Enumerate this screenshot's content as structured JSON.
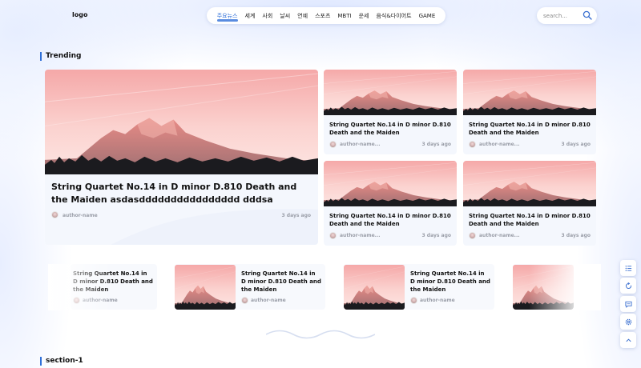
{
  "header": {
    "logo": "logo",
    "nav": [
      "주요뉴스",
      "세계",
      "사회",
      "날씨",
      "연예",
      "스포츠",
      "MBTI",
      "운세",
      "음식&다이어트",
      "GAME"
    ],
    "active_index": 0,
    "search_placeholder": "search..."
  },
  "trending": {
    "heading": "Trending",
    "featured": {
      "title": "String Quartet No.14 in D minor D.810 Death and the Maiden asdasdddddddddddddddd dddsa",
      "author": "author-name",
      "date": "3 days ago"
    },
    "grid": [
      {
        "title": "String Quartet No.14 in D minor D.810 Death and the Maiden asdasdddddddddddddddd...",
        "author": "author-name...",
        "date": "3 days ago"
      },
      {
        "title": "String Quartet No.14 in D minor D.810 Death and the Maiden asdasdddddddddddddddd...",
        "author": "author-name...",
        "date": "3 days ago"
      },
      {
        "title": "String Quartet No.14 in D minor D.810 Death and the Maiden asdasdddddddddddddddd...",
        "author": "author-name...",
        "date": "3 days ago"
      },
      {
        "title": "String Quartet No.14 in D minor D.810 Death and the Maiden asdasdddddddddddddddd...",
        "author": "author-name...",
        "date": "3 days ago"
      }
    ]
  },
  "carousel": [
    {
      "title": "String Quartet No.14 in D minor D.810 Death and the Maiden",
      "author": "author-name"
    },
    {
      "title": "String Quartet No.14 in D minor D.810 Death and the Maiden",
      "author": "author-name"
    },
    {
      "title": "String Quartet No.14 in D minor D.810 Death and the Maiden",
      "author": "author-name"
    }
  ],
  "section1": {
    "heading": "section-1"
  },
  "side_buttons": [
    "list-icon",
    "refresh-icon",
    "chat-icon",
    "settings-icon",
    "chevron-up-icon"
  ],
  "colors": {
    "accent": "#2f6fd8",
    "card_bg": "#f4f7fd",
    "meta_text": "#9a9ea8"
  }
}
